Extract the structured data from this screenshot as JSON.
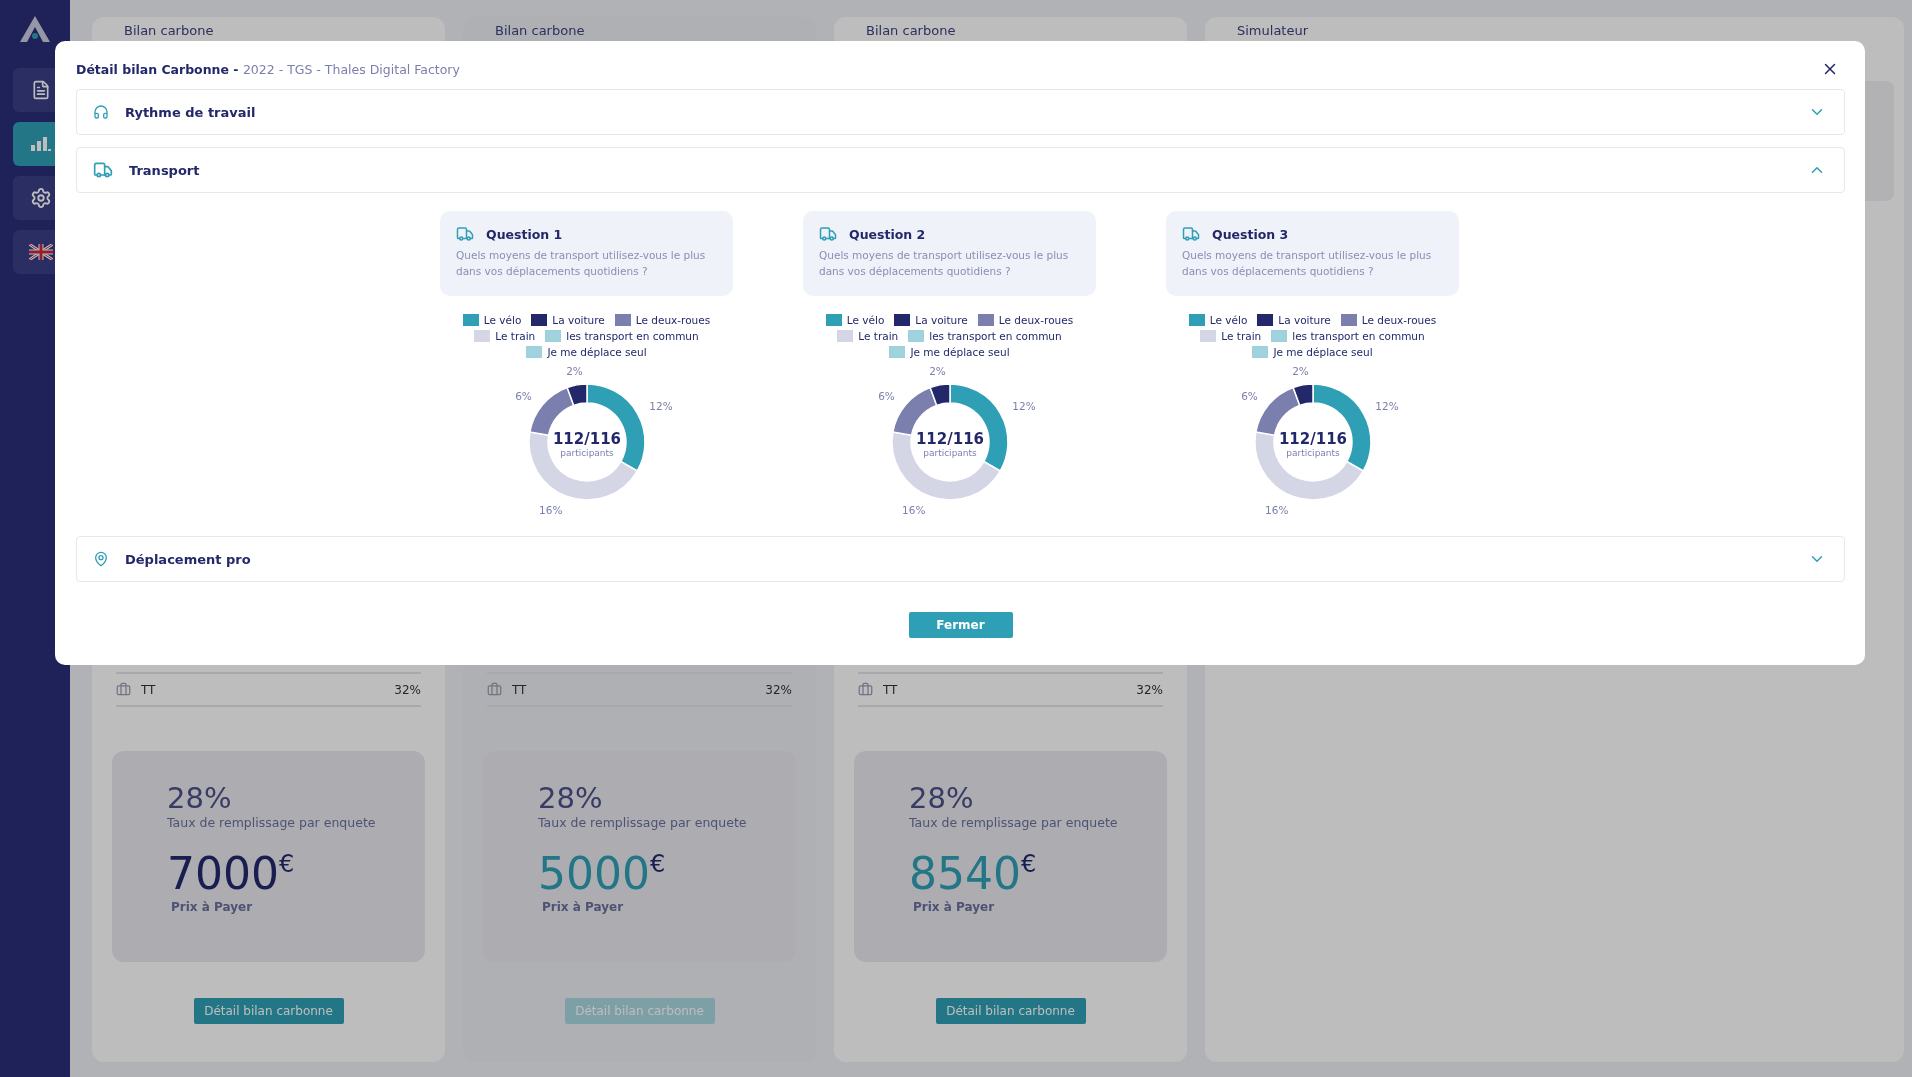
{
  "sidebar": {
    "items": [
      {
        "kind": "document",
        "selected": false
      },
      {
        "kind": "chart",
        "selected": true
      },
      {
        "kind": "settings",
        "selected": false
      },
      {
        "kind": "flag",
        "selected": false
      }
    ]
  },
  "cards": [
    {
      "title": "Bilan carbone",
      "disabled": false,
      "row": {
        "label": "TT",
        "value": "32%"
      },
      "rate": "28%",
      "rate_label": "Taux de remplissage par enquete",
      "price": "7000",
      "currency": "€",
      "price_label": "Prix à Payer",
      "kind": "primary",
      "button": "Détail bilan carbonne"
    },
    {
      "title": "Bilan carbone",
      "disabled": true,
      "row": {
        "label": "TT",
        "value": "32%"
      },
      "rate": "28%",
      "rate_label": "Taux de remplissage par enquete",
      "price": "5000",
      "currency": "€",
      "price_label": "Prix à Payer",
      "kind": "accent",
      "button": "Détail bilan carbonne"
    },
    {
      "title": "Bilan carbone",
      "disabled": false,
      "row": {
        "label": "TT",
        "value": "32%"
      },
      "rate": "28%",
      "rate_label": "Taux de remplissage par enquete",
      "price": "8540",
      "currency": "€",
      "price_label": "Prix à Payer",
      "kind": "accent",
      "button": "Détail bilan carbonne"
    }
  ],
  "simulator": {
    "title": "Simulateur"
  },
  "modal": {
    "title": "Détail bilan Carbonne - ",
    "subtitle": "2022 - TGS - Thales Digital Factory",
    "sections": [
      {
        "kind": "headset",
        "label": "Rythme de travail",
        "expanded": false
      },
      {
        "kind": "truck",
        "label": "Transport",
        "expanded": true,
        "questions": [
          {
            "title": "Question 1",
            "text": "Quels moyens de transport utilisez-vous le plus dans vos déplacements quotidiens ?",
            "center_value": "112/116",
            "center_label": "participants",
            "chart_data": {
              "type": "donut",
              "categories": [
                "Le vélo",
                "La voiture",
                "Le deux-roues",
                "Le train",
                "les transport en commun",
                "Je me déplace seul"
              ],
              "values": [
                12,
                2,
                6,
                16,
                null,
                null
              ],
              "colors": [
                "#2f9fb5",
                "#23286b",
                "#7b7fad",
                "#d4d6e6",
                "#9fd2dc",
                "#9fd2dc"
              ],
              "value_labels": [
                "12%",
                "2%",
                "6%",
                "16%",
                null,
                null
              ]
            }
          },
          {
            "title": "Question 2",
            "text": "Quels moyens de transport utilisez-vous le plus dans vos déplacements quotidiens ?",
            "center_value": "112/116",
            "center_label": "participants",
            "chart_data": {
              "type": "donut",
              "categories": [
                "Le vélo",
                "La voiture",
                "Le deux-roues",
                "Le train",
                "les transport en commun",
                "Je me déplace seul"
              ],
              "values": [
                12,
                2,
                6,
                16,
                null,
                null
              ],
              "colors": [
                "#2f9fb5",
                "#23286b",
                "#7b7fad",
                "#d4d6e6",
                "#9fd2dc",
                "#9fd2dc"
              ],
              "value_labels": [
                "12%",
                "2%",
                "6%",
                "16%",
                null,
                null
              ]
            }
          },
          {
            "title": "Question 3",
            "text": "Quels moyens de transport utilisez-vous le plus dans vos déplacements quotidiens ?",
            "center_value": "112/116",
            "center_label": "participants",
            "chart_data": {
              "type": "donut",
              "categories": [
                "Le vélo",
                "La voiture",
                "Le deux-roues",
                "Le train",
                "les transport en commun",
                "Je me déplace seul"
              ],
              "values": [
                12,
                2,
                6,
                16,
                null,
                null
              ],
              "colors": [
                "#2f9fb5",
                "#23286b",
                "#7b7fad",
                "#d4d6e6",
                "#9fd2dc",
                "#9fd2dc"
              ],
              "value_labels": [
                "12%",
                "2%",
                "6%",
                "16%",
                null,
                null
              ]
            }
          }
        ]
      },
      {
        "kind": "pin",
        "label": "Déplacement pro",
        "expanded": false
      }
    ],
    "button": "Fermer"
  }
}
